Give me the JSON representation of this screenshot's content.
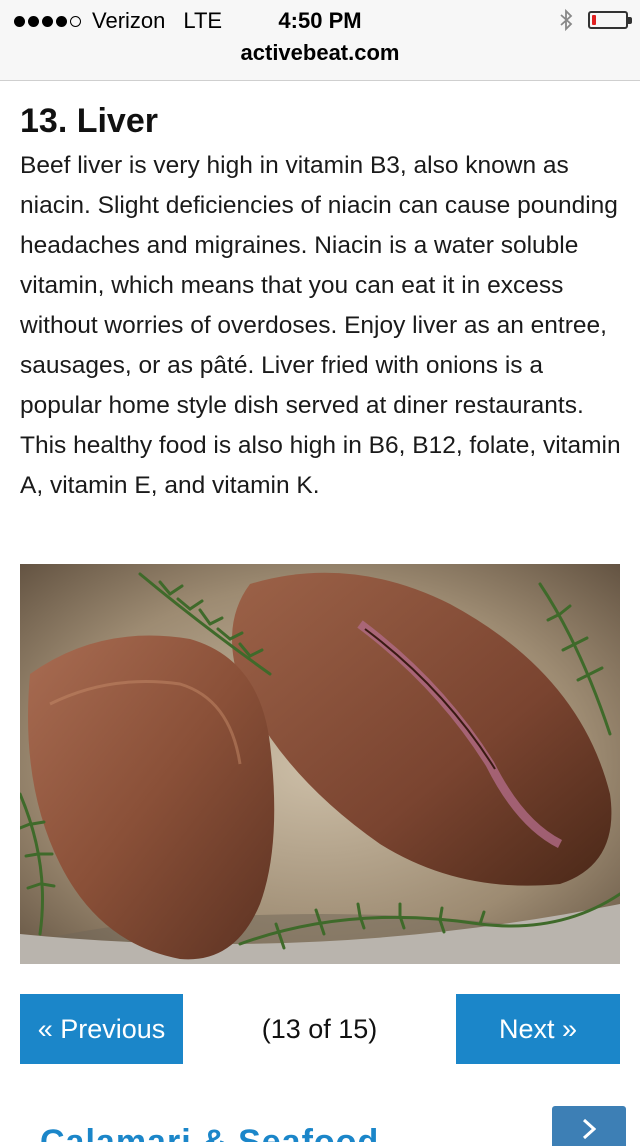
{
  "status_bar": {
    "carrier": "Verizon",
    "network": "LTE",
    "time": "4:50 PM",
    "signal_bars_filled": 4,
    "signal_bars_total": 5,
    "battery_level": 0.12,
    "battery_color": "#e02020"
  },
  "browser": {
    "url": "activebeat.com"
  },
  "article": {
    "title": "13. Liver",
    "body": "Beef liver is very high in vitamin B3, also known as niacin. Slight deficiencies of niacin can cause pounding headaches and migraines. Niacin is a water soluble vitamin, which means that you can eat it in excess without worries of overdoses. Enjoy liver as an entree, sausages, or as pâté. Liver fried with onions is a popular home style dish served at diner restaurants. This healthy food is also high in B6, B12, folate, vitamin A, vitamin E, and vitamin K."
  },
  "pagination": {
    "previous_label": "« Previous",
    "next_label": "Next »",
    "page_indicator": "(13 of 15)",
    "button_color": "#1b86c9"
  },
  "next_teaser": {
    "partial_label": "Calamari & Seafood",
    "button_icon": "chevron-right-icon"
  }
}
